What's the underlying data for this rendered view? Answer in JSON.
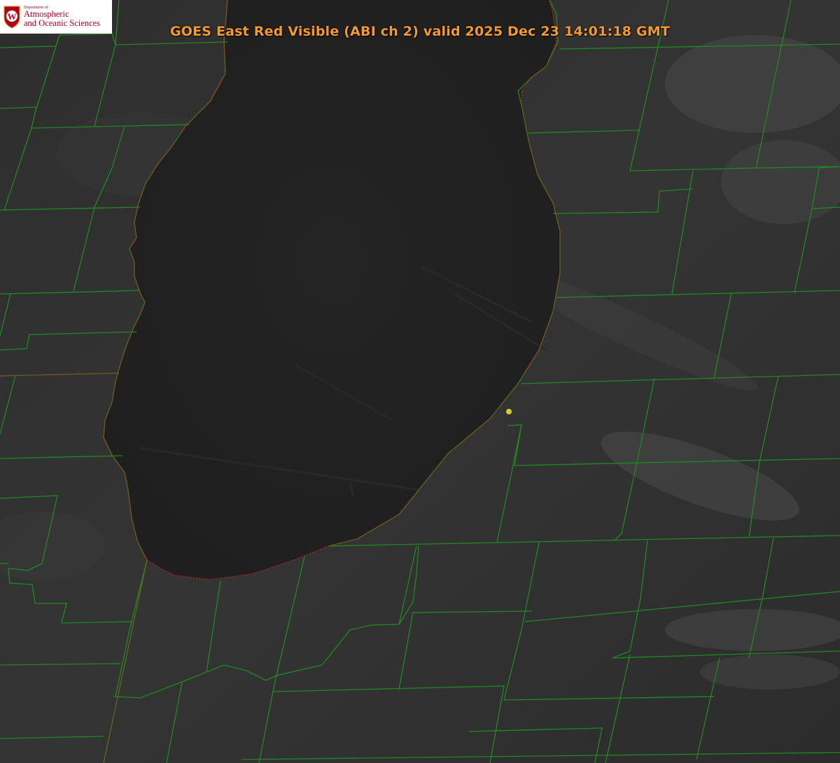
{
  "title": "GOES East Red Visible (ABI ch 2) valid 2025 Dec 23 14:01:18 GMT",
  "logo": {
    "dept_line": "Department of",
    "line1": "Atmospheric",
    "line2": "and Oceanic Sciences",
    "crest_letter": "W"
  },
  "colors": {
    "county_lines": "#1f8a1f",
    "coastline": "#d42020",
    "marker": "#d8d020",
    "title": "#f39a2a",
    "logo_text": "#b00020"
  },
  "layers": [
    "satellite-visible-imagery",
    "county-boundaries",
    "lake-michigan-shoreline",
    "location-marker"
  ]
}
